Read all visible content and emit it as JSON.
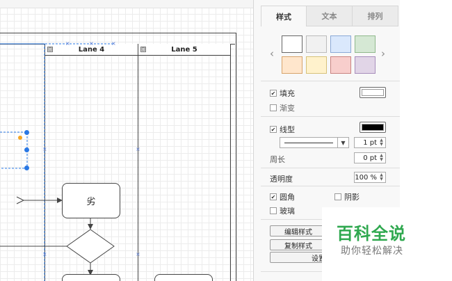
{
  "lanes": [
    {
      "label": "Lane 4",
      "toggle": "⊟"
    },
    {
      "label": "Lane 5",
      "toggle": "⊟"
    }
  ],
  "shapes": {
    "process_label": "劣"
  },
  "panel": {
    "tabs": [
      {
        "label": "样式",
        "active": true
      },
      {
        "label": "文本",
        "active": false
      },
      {
        "label": "排列",
        "active": false
      }
    ],
    "swatches": [
      "#ffffff",
      "#f1f1f1",
      "#dae8fc",
      "#d5e8d4",
      "#ffe6cc",
      "#fff2cc",
      "#f8cecc",
      "#e1d5e7"
    ],
    "fill": {
      "label": "填充",
      "checked": true,
      "color": "#ffffff"
    },
    "gradient": {
      "label": "渐变",
      "checked": false
    },
    "line": {
      "label": "线型",
      "checked": true,
      "color": "#000000",
      "width": "1 pt"
    },
    "perimeter": {
      "label": "周长",
      "value": "0 pt"
    },
    "opacity": {
      "label": "透明度",
      "value": "100 %"
    },
    "rounded": {
      "label": "圆角",
      "checked": true
    },
    "shadow": {
      "label": "阴影",
      "checked": false
    },
    "glass": {
      "label": "玻璃",
      "checked": false
    },
    "buttons": {
      "edit_style": "编辑样式",
      "copy_style": "复制样式",
      "set_default": "设置为"
    }
  },
  "watermark": {
    "title": "百科全说",
    "subtitle": "助你轻松解决"
  }
}
